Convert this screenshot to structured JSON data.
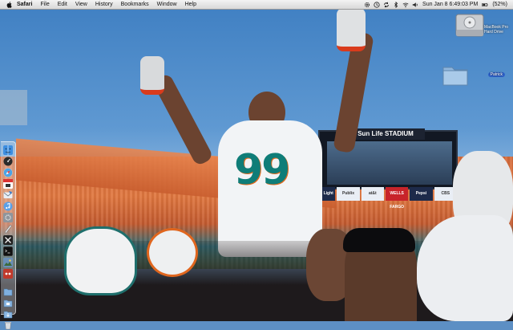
{
  "menubar": {
    "apple_icon": "apple-icon",
    "app_name": "Safari",
    "items": [
      "File",
      "Edit",
      "View",
      "History",
      "Bookmarks",
      "Window",
      "Help"
    ],
    "status_icons": [
      "gear-icon",
      "time-machine-icon",
      "sync-icon",
      "bluetooth-icon",
      "wifi-icon",
      "volume-icon"
    ],
    "datetime": "Sun Jan 8  6:49:03 PM",
    "battery_icon": "battery-icon",
    "battery_text": "(52%)"
  },
  "desktop": {
    "icons": [
      {
        "name": "hard-drive-icon",
        "label": "MacBook Pro Hard Drive"
      },
      {
        "name": "folder-icon",
        "label": "Patrick",
        "selected": true
      }
    ]
  },
  "wallpaper": {
    "scoreboard_title": "Sun Life STADIUM",
    "sponsors": [
      "Bud Light",
      "Publix",
      "at&t",
      "WELLS FARGO",
      "Pepsi",
      "CBS"
    ],
    "jersey_number": "99"
  },
  "dock": {
    "items": [
      "finder-icon",
      "dashboard-icon",
      "safari-icon",
      "calendar-icon",
      "mail-icon",
      "itunes-icon",
      "system-preferences-icon",
      "script-editor-icon",
      "x11-icon",
      "terminal-icon",
      "photo-icon",
      "games-icon"
    ],
    "stacks": [
      "applications-folder-icon",
      "documents-folder-icon",
      "downloads-folder-icon",
      "trash-icon"
    ]
  },
  "colors": {
    "menubar": "#e4e4e4",
    "selection": "#2f62c9",
    "dolphins_aqua": "#0f7d78",
    "dolphins_orange": "#e1691d"
  }
}
